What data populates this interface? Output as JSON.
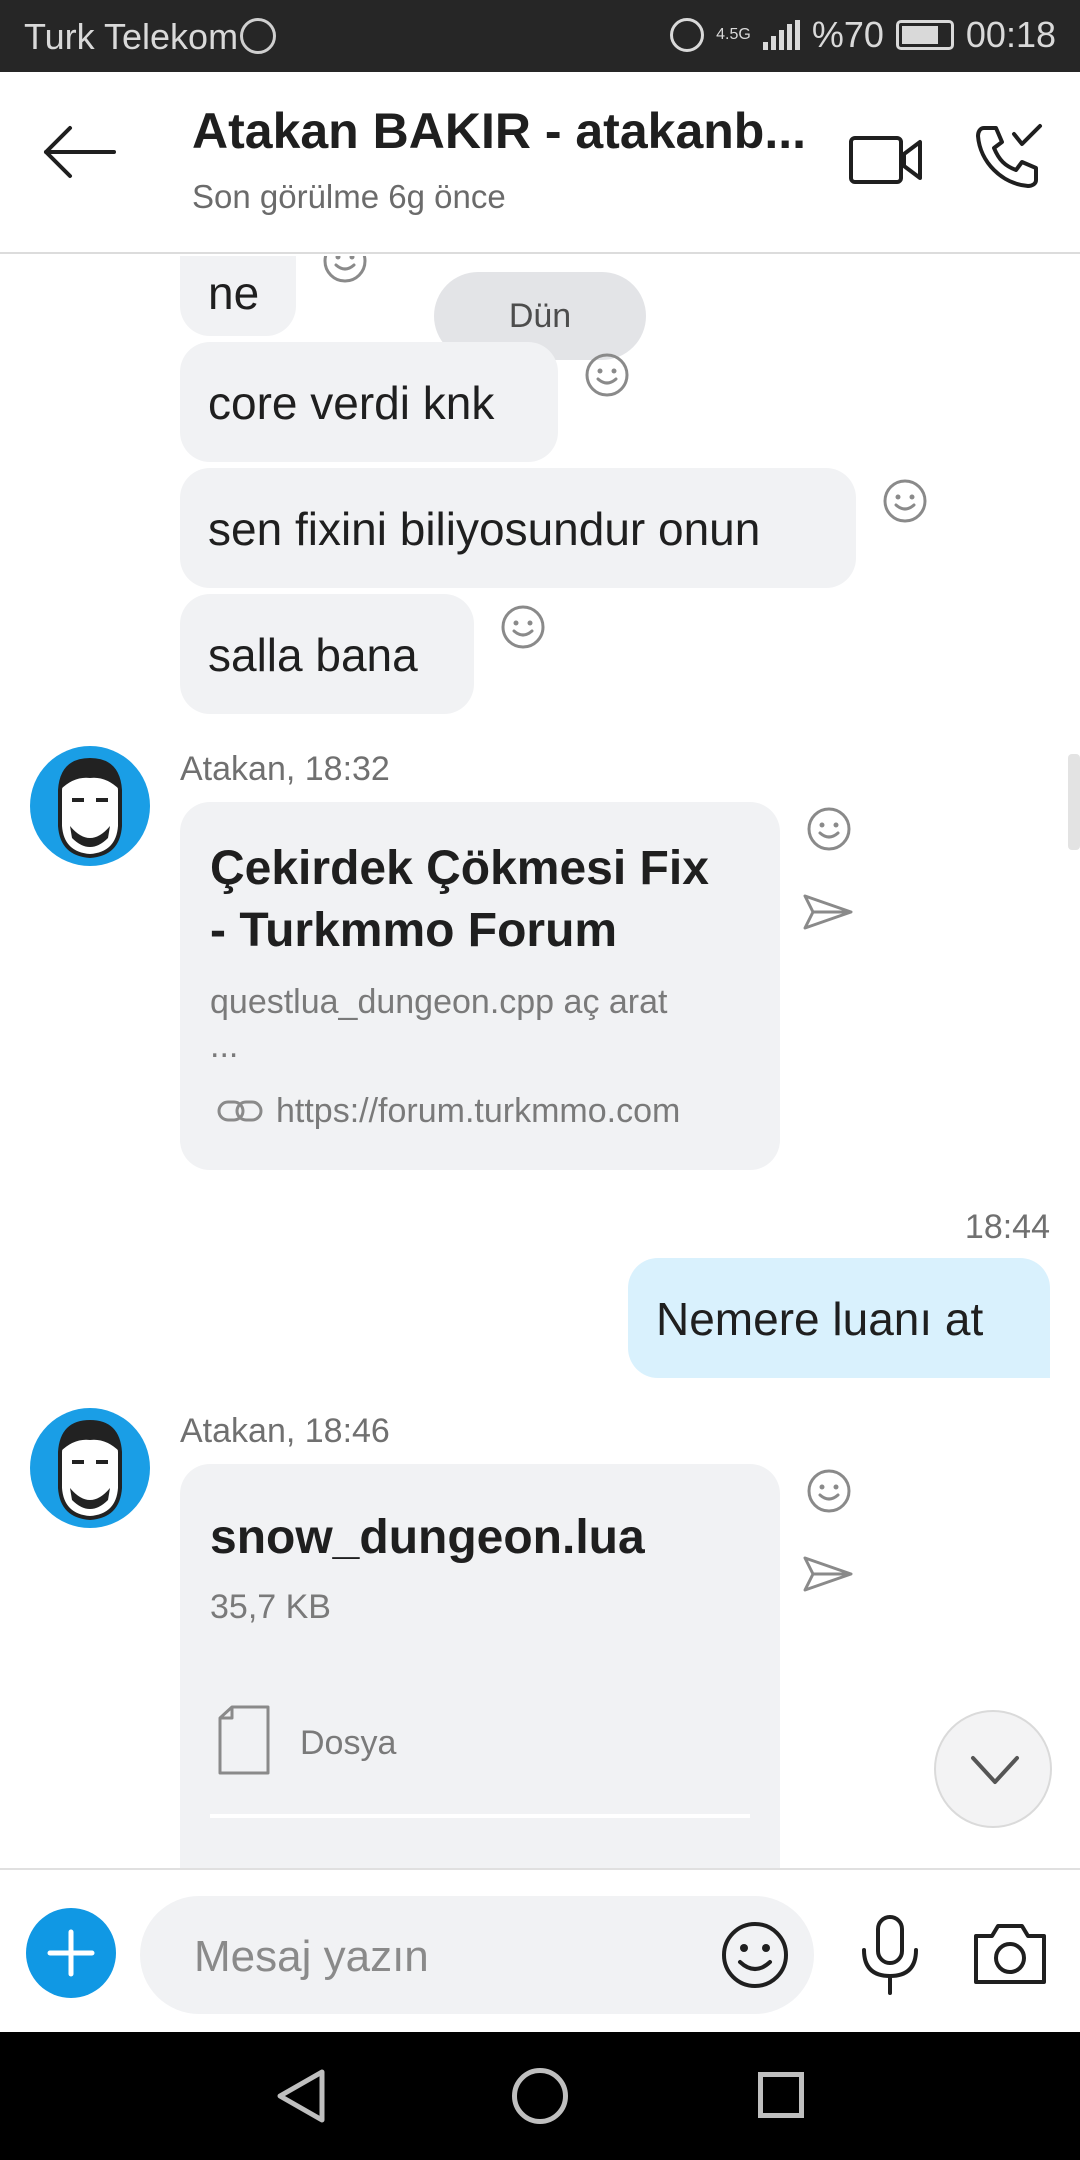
{
  "status_bar": {
    "carrier": "Turk Telekom",
    "network": "4.5G",
    "battery": "%70",
    "time": "00:18",
    "icons": [
      "alarm-icon",
      "signal-icon",
      "battery-icon"
    ]
  },
  "header": {
    "title": "Atakan BAKIR - atakanb...",
    "subtitle": "Son görülme 6g önce",
    "icons": [
      "back-arrow-icon",
      "video-camera-icon",
      "phone-call-icon"
    ]
  },
  "chat": {
    "date_separator": "Dün",
    "incoming_messages": [
      "ne",
      "core verdi knk",
      "sen fixini biliyosundur onun",
      "salla bana"
    ],
    "link_message": {
      "sender_time": "Atakan, 18:32",
      "title_line1": "Çekirdek Çökmesi Fix",
      "title_line2": "- Turkmmo Forum",
      "description": "questlua_dungeon.cpp aç arat",
      "ellipsis": "...",
      "url": "https://forum.turkmmo.com"
    },
    "outgoing_message": {
      "time": "18:44",
      "text": "Nemere luanı at"
    },
    "file_message": {
      "sender_time": "Atakan, 18:46",
      "filename": "snow_dungeon.lua",
      "size": "35,7 KB",
      "type_label": "Dosya"
    }
  },
  "composer": {
    "placeholder": "Mesaj yazın",
    "icons": [
      "plus-icon",
      "emoji-icon",
      "microphone-icon",
      "camera-icon"
    ]
  },
  "colors": {
    "accent": "#1098e4",
    "incoming_bubble": "#f1f2f4",
    "outgoing_bubble": "#d9f1fd",
    "avatar_bg": "#1a9ee6"
  }
}
